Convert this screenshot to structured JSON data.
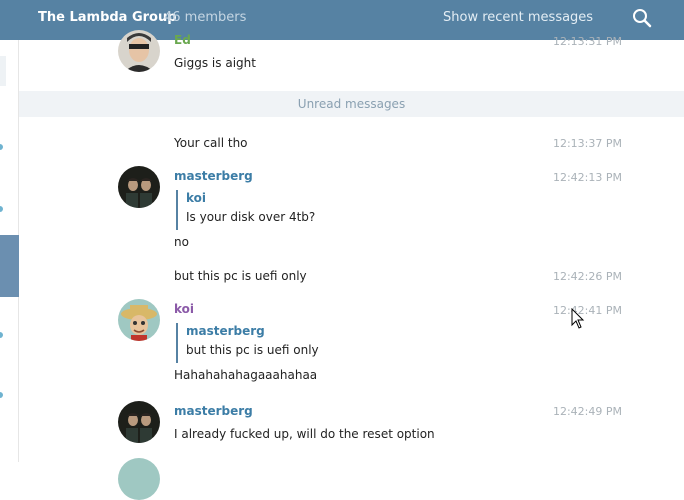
{
  "header": {
    "title": "The Lambda Group",
    "members": "46 members",
    "recent_label": "Show recent messages"
  },
  "divider": "Unread messages",
  "messages": [
    {
      "author": "Ed",
      "text": "Giggs is aight",
      "time": "12:13:31 PM"
    },
    {
      "author": "",
      "text": "Your call tho",
      "time": "12:13:37 PM"
    },
    {
      "author": "masterberg",
      "reply_to": "koi",
      "reply_text": "Is your disk over 4tb?",
      "text": "no",
      "time": "12:42:13 PM"
    },
    {
      "author": "",
      "text": "but this pc is uefi only",
      "time": "12:42:26 PM"
    },
    {
      "author": "koi",
      "reply_to": "masterberg",
      "reply_text": "but this pc is uefi only",
      "text": "Hahahahahagaaahahaa",
      "time": "12:42:41 PM"
    },
    {
      "author": "masterberg",
      "text": "I already fucked up, will do the reset option",
      "time": "12:42:49 PM"
    }
  ],
  "colors": {
    "header_bg": "#5682a3",
    "ed": "#6aa84f",
    "masterberg": "#3c7da6",
    "koi": "#8b5aa8"
  }
}
